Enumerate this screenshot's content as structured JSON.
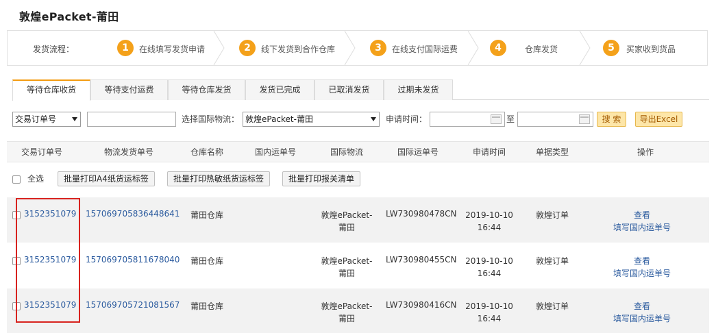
{
  "page": {
    "title": "敦煌ePacket-莆田"
  },
  "steps": {
    "label": "发货流程：",
    "items": [
      {
        "num": "1",
        "text": "在线填写发货申请"
      },
      {
        "num": "2",
        "text": "线下发货到合作仓库"
      },
      {
        "num": "3",
        "text": "在线支付国际运费"
      },
      {
        "num": "4",
        "text": "仓库发货"
      },
      {
        "num": "5",
        "text": "买家收到货品"
      }
    ]
  },
  "tabs": [
    {
      "label": "等待仓库收货"
    },
    {
      "label": "等待支付运费"
    },
    {
      "label": "等待仓库发货"
    },
    {
      "label": "发货已完成"
    },
    {
      "label": "已取消发货"
    },
    {
      "label": "过期未发货"
    }
  ],
  "filter": {
    "type_select": "交易订单号",
    "logistics_label": "选择国际物流：",
    "logistics_select": "敦煌ePacket-莆田",
    "time_label": "申请时间：",
    "to_label": "至",
    "search_btn": "搜 索",
    "export_btn": "导出Excel"
  },
  "table": {
    "headers": [
      "交易订单号",
      "物流发货单号",
      "仓库名称",
      "国内运单号",
      "国际物流",
      "国际运单号",
      "申请时间",
      "单据类型",
      "操作"
    ],
    "select_all": "全选",
    "bulk_buttons": [
      "批量打印A4纸货运标签",
      "批量打印热敏纸货运标签",
      "批量打印报关清单"
    ],
    "rows": [
      {
        "order": "3152351079",
        "ship_no": "157069705836448641",
        "warehouse": "莆田仓库",
        "domestic": "",
        "logistics_1": "敦煌ePacket-",
        "logistics_2": "莆田",
        "intl_no": "LW730980478CN",
        "date": "2019-10-10",
        "time": "16:44",
        "type": "敦煌订单",
        "action_1": "查看",
        "action_2": "填写国内运单号"
      },
      {
        "order": "3152351079",
        "ship_no": "157069705811678040",
        "warehouse": "莆田仓库",
        "domestic": "",
        "logistics_1": "敦煌ePacket-",
        "logistics_2": "莆田",
        "intl_no": "LW730980455CN",
        "date": "2019-10-10",
        "time": "16:44",
        "type": "敦煌订单",
        "action_1": "查看",
        "action_2": "填写国内运单号"
      },
      {
        "order": "3152351079",
        "ship_no": "157069705721081567",
        "warehouse": "莆田仓库",
        "domestic": "",
        "logistics_1": "敦煌ePacket-",
        "logistics_2": "莆田",
        "intl_no": "LW730980416CN",
        "date": "2019-10-10",
        "time": "16:44",
        "type": "敦煌订单",
        "action_1": "查看",
        "action_2": "填写国内运单号"
      }
    ]
  },
  "colors": {
    "accent": "#f4a11a",
    "link": "#2a5a9e",
    "highlight": "#d8231f"
  }
}
